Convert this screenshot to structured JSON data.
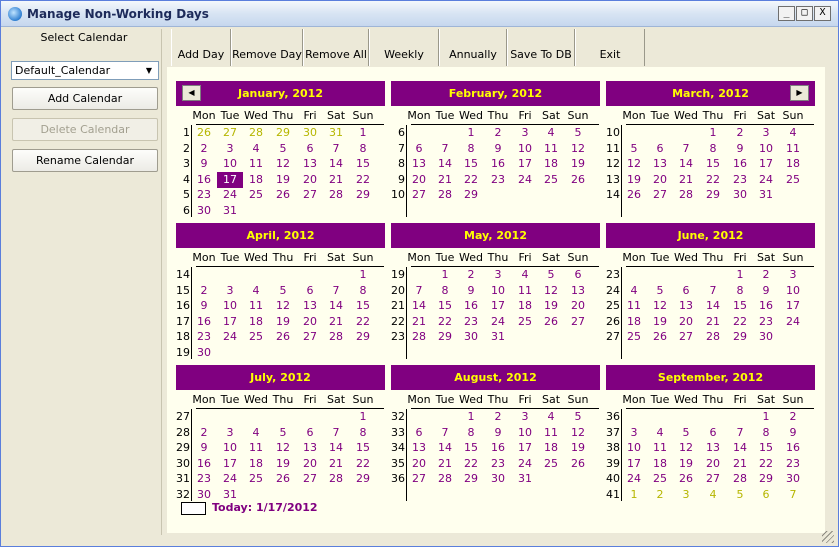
{
  "window": {
    "title": "Manage Non-Working Days",
    "min": "_",
    "max": "□",
    "close": "X"
  },
  "left": {
    "select_label": "Select Calendar",
    "calendar_value": "Default_Calendar",
    "add": "Add Calendar",
    "delete": "Delete Calendar",
    "rename": "Rename Calendar"
  },
  "toolbar": [
    {
      "label": "Add Day"
    },
    {
      "label": "Remove Day"
    },
    {
      "label": "Remove All"
    },
    {
      "label": "Weekly"
    },
    {
      "label": "Annually"
    },
    {
      "label": "Save To DB"
    },
    {
      "label": "Exit"
    }
  ],
  "dow": [
    "Mon",
    "Tue",
    "Wed",
    "Thu",
    "Fri",
    "Sat",
    "Sun"
  ],
  "months": [
    {
      "title": "January, 2012",
      "weeks": [
        1,
        2,
        3,
        4,
        5,
        6
      ],
      "lead": [
        26,
        27,
        28,
        29,
        30,
        31
      ],
      "days": 31,
      "trail": []
    },
    {
      "title": "February, 2012",
      "weeks": [
        6,
        7,
        8,
        9,
        10
      ],
      "lead": [],
      "days": 29,
      "trail": []
    },
    {
      "title": "March, 2012",
      "weeks": [
        10,
        11,
        12,
        13,
        14
      ],
      "lead": [],
      "days": 31,
      "trail": []
    },
    {
      "title": "April, 2012",
      "weeks": [
        14,
        15,
        16,
        17,
        18,
        19
      ],
      "lead": [],
      "days": 30,
      "trail": []
    },
    {
      "title": "May, 2012",
      "weeks": [
        19,
        20,
        21,
        22,
        23
      ],
      "lead": [],
      "days": 31,
      "trail": []
    },
    {
      "title": "June, 2012",
      "weeks": [
        23,
        24,
        25,
        26,
        27
      ],
      "lead": [],
      "days": 30,
      "trail": []
    },
    {
      "title": "July, 2012",
      "weeks": [
        27,
        28,
        29,
        30,
        31,
        32
      ],
      "lead": [],
      "days": 31,
      "trail": []
    },
    {
      "title": "August, 2012",
      "weeks": [
        32,
        33,
        34,
        35,
        36
      ],
      "lead": [],
      "days": 31,
      "trail": []
    },
    {
      "title": "September, 2012",
      "weeks": [
        36,
        37,
        38,
        39,
        40,
        41
      ],
      "lead": [],
      "days": 30,
      "trail": [
        1,
        2,
        3,
        4,
        5,
        6,
        7
      ]
    }
  ],
  "month_start_dow": [
    6,
    2,
    3,
    6,
    1,
    4,
    6,
    2,
    5
  ],
  "today_label": "Today: 1/17/2012",
  "selected_day": {
    "month": 0,
    "day": 17
  },
  "colors": {
    "header_bg": "#800080",
    "header_text": "#ffff00",
    "day_text": "#800080",
    "other_text": "#b6b600"
  },
  "icons": {
    "prev": "◀",
    "next": "▶",
    "dropdown": "▼"
  }
}
